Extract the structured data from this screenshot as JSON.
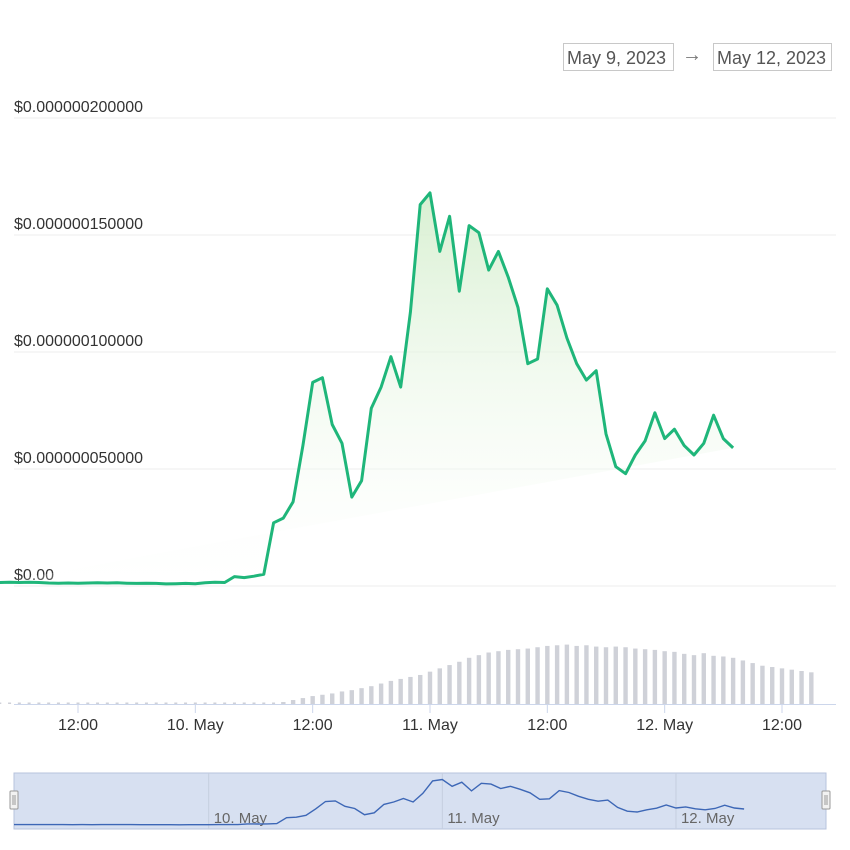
{
  "date_range": {
    "from": "May 9, 2023",
    "arrow": "→",
    "to": "May 12, 2023"
  },
  "colors": {
    "line": "#1fb67a",
    "fill_top": "#d6efcf",
    "volume": "#cfd1d8",
    "grid": "#ececec",
    "navigator_mask": "#d3ddf0",
    "navigator_line": "#3d67b6"
  },
  "chart_data": {
    "type": "area",
    "title": "",
    "xlabel": "",
    "ylabel": "",
    "y_tick_labels": [
      "$0.00",
      "$0.000000050000",
      "$0.000000100000",
      "$0.000000150000",
      "$0.000000200000"
    ],
    "y_ticks": [
      0,
      5e-08,
      1e-07,
      1.5e-07,
      2e-07
    ],
    "ylim": [
      0,
      2e-07
    ],
    "x_tick_labels": [
      "12:00",
      "10. May",
      "12:00",
      "11. May",
      "12:00",
      "12. May",
      "12:00"
    ],
    "x_ticks": [
      "2023-05-09 12:00",
      "2023-05-10 00:00",
      "2023-05-10 12:00",
      "2023-05-11 00:00",
      "2023-05-11 12:00",
      "2023-05-12 00:00",
      "2023-05-12 12:00"
    ],
    "grid": true,
    "x": [
      "2023-05-09 04:00",
      "2023-05-09 05:00",
      "2023-05-09 06:00",
      "2023-05-09 07:00",
      "2023-05-09 08:00",
      "2023-05-09 09:00",
      "2023-05-09 10:00",
      "2023-05-09 11:00",
      "2023-05-09 12:00",
      "2023-05-09 13:00",
      "2023-05-09 14:00",
      "2023-05-09 15:00",
      "2023-05-09 16:00",
      "2023-05-09 17:00",
      "2023-05-09 18:00",
      "2023-05-09 19:00",
      "2023-05-09 20:00",
      "2023-05-09 21:00",
      "2023-05-09 22:00",
      "2023-05-09 23:00",
      "2023-05-10 00:00",
      "2023-05-10 01:00",
      "2023-05-10 02:00",
      "2023-05-10 03:00",
      "2023-05-10 04:00",
      "2023-05-10 05:00",
      "2023-05-10 06:00",
      "2023-05-10 07:00",
      "2023-05-10 08:00",
      "2023-05-10 09:00",
      "2023-05-10 10:00",
      "2023-05-10 11:00",
      "2023-05-10 12:00",
      "2023-05-10 13:00",
      "2023-05-10 14:00",
      "2023-05-10 15:00",
      "2023-05-10 16:00",
      "2023-05-10 17:00",
      "2023-05-10 18:00",
      "2023-05-10 19:00",
      "2023-05-10 20:00",
      "2023-05-10 21:00",
      "2023-05-10 22:00",
      "2023-05-10 23:00",
      "2023-05-11 00:00",
      "2023-05-11 01:00",
      "2023-05-11 02:00",
      "2023-05-11 03:00",
      "2023-05-11 04:00",
      "2023-05-11 05:00",
      "2023-05-11 06:00",
      "2023-05-11 07:00",
      "2023-05-11 08:00",
      "2023-05-11 09:00",
      "2023-05-11 10:00",
      "2023-05-11 11:00",
      "2023-05-11 12:00",
      "2023-05-11 13:00",
      "2023-05-11 14:00",
      "2023-05-11 15:00",
      "2023-05-11 16:00",
      "2023-05-11 17:00",
      "2023-05-11 18:00",
      "2023-05-11 19:00",
      "2023-05-11 20:00",
      "2023-05-11 21:00",
      "2023-05-11 22:00",
      "2023-05-11 23:00",
      "2023-05-12 00:00",
      "2023-05-12 01:00",
      "2023-05-12 02:00",
      "2023-05-12 03:00",
      "2023-05-12 04:00",
      "2023-05-12 05:00",
      "2023-05-12 06:00",
      "2023-05-12 07:00",
      "2023-05-12 08:00",
      "2023-05-12 09:00",
      "2023-05-12 10:00",
      "2023-05-12 11:00",
      "2023-05-12 12:00",
      "2023-05-12 13:00",
      "2023-05-12 14:00",
      "2023-05-12 15:00"
    ],
    "series": [
      {
        "values": [
          1.5e-09,
          1.6e-09,
          1.5e-09,
          1.6e-09,
          1.5e-09,
          1.3e-09,
          1.2e-09,
          1.3e-09,
          1.2e-09,
          1.3e-09,
          1.4e-09,
          1.3e-09,
          1.4e-09,
          1.2e-09,
          1.1e-09,
          1.2e-09,
          1.1e-09,
          9e-10,
          1e-09,
          1.1e-09,
          1e-09,
          1.4e-09,
          1.6e-09,
          1.5e-09,
          4e-09,
          3.6e-09,
          4.2e-09,
          5e-09,
          2.7e-08,
          2.9e-08,
          3.6e-08,
          6e-08,
          8.7e-08,
          8.9e-08,
          6.9e-08,
          6.1e-08,
          3.8e-08,
          4.5e-08,
          7.6e-08,
          8.5e-08,
          9.8e-08,
          8.5e-08,
          1.17e-07,
          1.63e-07,
          1.68e-07,
          1.43e-07,
          1.58e-07,
          1.26e-07,
          1.54e-07,
          1.51e-07,
          1.35e-07,
          1.43e-07,
          1.32e-07,
          1.19e-07,
          9.5e-08,
          9.7e-08,
          1.27e-07,
          1.2e-07,
          1.06e-07,
          9.5e-08,
          8.8e-08,
          9.2e-08,
          6.5e-08,
          5.1e-08,
          4.8e-08,
          5.6e-08,
          6.2e-08,
          7.4e-08,
          6.3e-08,
          6.7e-08,
          6e-08,
          5.6e-08,
          6.1e-08,
          7.3e-08,
          6.3e-08,
          5.9e-08
        ]
      }
    ],
    "volume": [
      0,
      0,
      0,
      0,
      0,
      0,
      0,
      0,
      0,
      0,
      0,
      0,
      0,
      0,
      0,
      0,
      0,
      0,
      0,
      0,
      0,
      0,
      0,
      0,
      0,
      0,
      0,
      0,
      0,
      0.03,
      0.06,
      0.09,
      0.12,
      0.14,
      0.16,
      0.19,
      0.21,
      0.24,
      0.27,
      0.31,
      0.35,
      0.38,
      0.41,
      0.44,
      0.49,
      0.54,
      0.59,
      0.64,
      0.7,
      0.74,
      0.78,
      0.8,
      0.82,
      0.83,
      0.84,
      0.86,
      0.88,
      0.89,
      0.9,
      0.88,
      0.89,
      0.87,
      0.86,
      0.87,
      0.86,
      0.84,
      0.83,
      0.82,
      0.8,
      0.79,
      0.76,
      0.74,
      0.77,
      0.73,
      0.72,
      0.7,
      0.66,
      0.62,
      0.58,
      0.56,
      0.54,
      0.52,
      0.5,
      0.48,
      0.46,
      0.43
    ],
    "navigator_labels": [
      "10. May",
      "11. May",
      "12. May"
    ]
  }
}
